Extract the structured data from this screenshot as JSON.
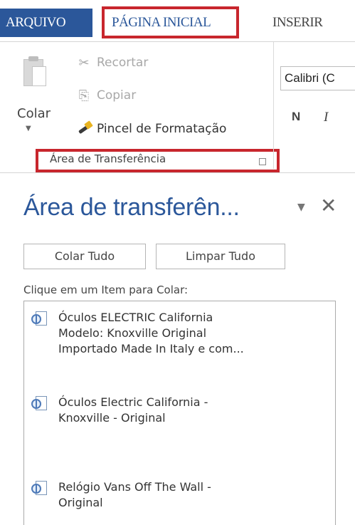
{
  "ribbon_tabs": {
    "file": "ARQUIVO",
    "home": "PÁGINA INICIAL",
    "insert": "INSERIR"
  },
  "clipboard_group": {
    "paste_label": "Colar",
    "cut_label": "Recortar",
    "copy_label": "Copiar",
    "format_painter_label": "Pincel de Formatação",
    "group_label": "Área de Transferência"
  },
  "font_group": {
    "font_name": "Calibri (C",
    "bold_label": "N",
    "italic_label": "I"
  },
  "clipboard_pane": {
    "title": "Área de transferên...",
    "paste_all_label": "Colar Tudo",
    "clear_all_label": "Limpar Tudo",
    "hint": "Clique em um Item para Colar:",
    "items": [
      {
        "lines": [
          "Óculos ELECTRIC California",
          "Modelo: Knoxville Original",
          "Importado Made In Italy e com..."
        ]
      },
      {
        "lines": [
          "Óculos Electric California -",
          "Knoxville - Original"
        ]
      },
      {
        "lines": [
          "Relógio Vans Off The Wall -",
          "Original"
        ]
      }
    ]
  },
  "colors": {
    "accent": "#2b579a",
    "highlight_box": "#c8262d"
  }
}
